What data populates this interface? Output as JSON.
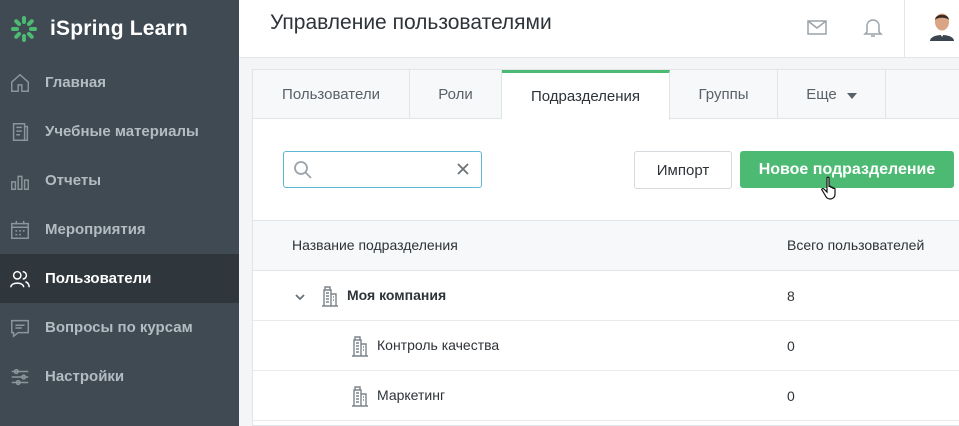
{
  "app": {
    "brand_name": "iSpring Learn",
    "accent_color": "#4cba72"
  },
  "sidebar": {
    "items": [
      {
        "label": "Главная",
        "icon": "home-icon",
        "active": false
      },
      {
        "label": "Учебные материалы",
        "icon": "book-icon",
        "active": false
      },
      {
        "label": "Отчеты",
        "icon": "bar-chart-icon",
        "active": false
      },
      {
        "label": "Мероприятия",
        "icon": "calendar-icon",
        "active": false
      },
      {
        "label": "Пользователи",
        "icon": "users-icon",
        "active": true
      },
      {
        "label": "Вопросы по курсам",
        "icon": "chat-icon",
        "active": false
      },
      {
        "label": "Настройки",
        "icon": "sliders-icon",
        "active": false
      }
    ]
  },
  "header": {
    "title": "Управление пользователями"
  },
  "tabs": [
    {
      "label": "Пользователи",
      "active": false
    },
    {
      "label": "Роли",
      "active": false
    },
    {
      "label": "Подразделения",
      "active": true
    },
    {
      "label": "Группы",
      "active": false
    },
    {
      "label": "Еще",
      "active": false,
      "dropdown": true
    }
  ],
  "toolbar": {
    "search_value": "",
    "import_label": "Импорт",
    "new_label": "Новое подразделение"
  },
  "table": {
    "columns": [
      "Название подразделения",
      "Всего пользователей"
    ],
    "rows": [
      {
        "name": "Моя компания",
        "count": "8",
        "level": 0,
        "expanded": true
      },
      {
        "name": "Контроль качества",
        "count": "0",
        "level": 1
      },
      {
        "name": "Маркетинг",
        "count": "0",
        "level": 1
      }
    ]
  }
}
